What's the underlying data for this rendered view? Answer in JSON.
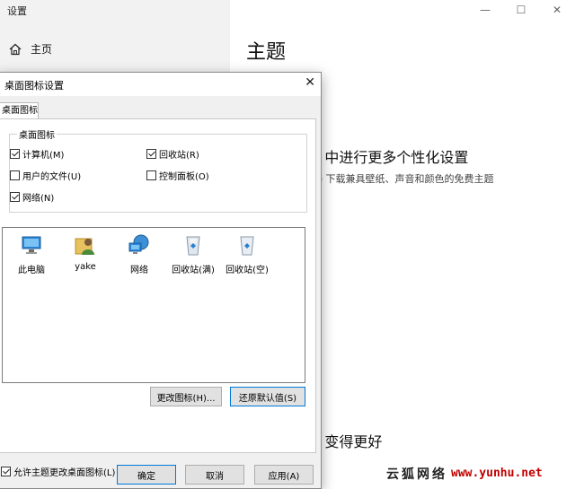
{
  "settings": {
    "window_title": "设置",
    "home_label": "主页",
    "minimize_glyph": "—",
    "maximize_glyph": "☐",
    "close_glyph": "✕",
    "main_heading": "主题",
    "personalize_heading": "s 中进行更多个性化设置",
    "personalize_sub": "re 下载兼具壁纸、声音和颜色的免费主题",
    "better_heading": "s 变得更好"
  },
  "dialog": {
    "title": "桌面图标设置",
    "close_glyph": "✕",
    "tab_label": "桌面图标",
    "group_label": "桌面图标",
    "checkboxes": [
      {
        "label": "计算机(M)",
        "checked": true
      },
      {
        "label": "回收站(R)",
        "checked": true
      },
      {
        "label": "用户的文件(U)",
        "checked": false
      },
      {
        "label": "控制面板(O)",
        "checked": false
      },
      {
        "label": "网络(N)",
        "checked": true
      }
    ],
    "icons": [
      {
        "label": "此电脑",
        "icon": "computer-icon"
      },
      {
        "label": "yake",
        "icon": "user-folder-icon"
      },
      {
        "label": "网络",
        "icon": "network-icon"
      },
      {
        "label": "回收站(满)",
        "icon": "recycle-bin-full-icon"
      },
      {
        "label": "回收站(空)",
        "icon": "recycle-bin-empty-icon"
      }
    ],
    "change_icon_button": "更改图标(H)...",
    "restore_default_button": "还原默认值(S)",
    "allow_theme_label": "允许主题更改桌面图标(L)",
    "allow_theme_checked": true,
    "ok_button": "确定",
    "cancel_button": "取消",
    "apply_button": "应用(A)"
  },
  "watermark": {
    "chinese": "云狐网络",
    "url": "www.yunhu.net"
  },
  "colors": {
    "accent": "#0078d7",
    "sidebar_bg": "#f2f2f2",
    "dialog_bg": "#f0f0f0",
    "watermark_red": "#c00000"
  }
}
